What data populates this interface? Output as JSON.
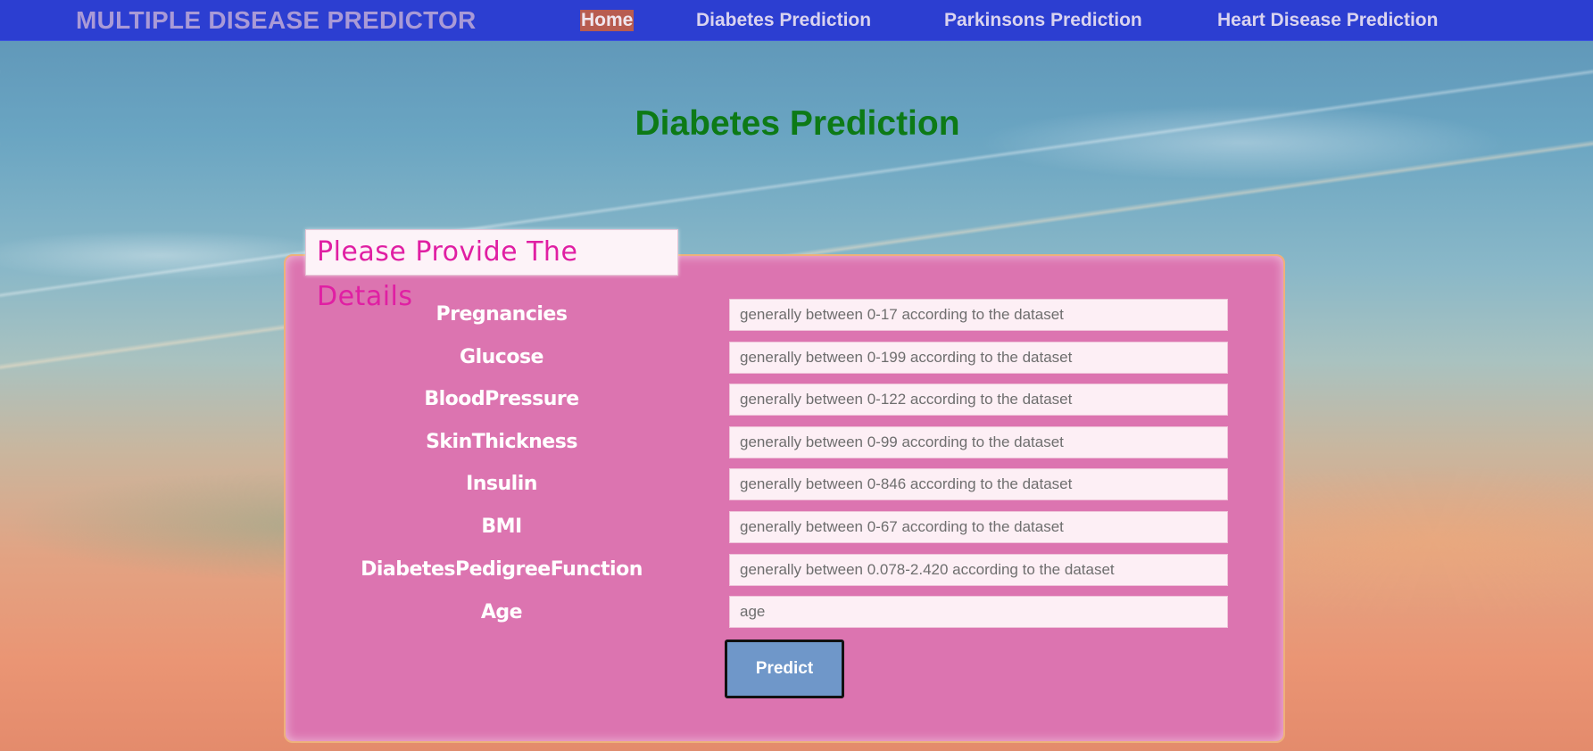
{
  "navbar": {
    "brand": "MULTIPLE DISEASE PREDICTOR",
    "items": [
      {
        "label": "Home",
        "active": true
      },
      {
        "label": "Diabetes Prediction",
        "active": false
      },
      {
        "label": "Parkinsons Prediction",
        "active": false
      },
      {
        "label": "Heart Disease Prediction",
        "active": false
      }
    ]
  },
  "page": {
    "title": "Diabetes Prediction"
  },
  "form": {
    "legend": "Please Provide The Details",
    "fields": [
      {
        "label": "Pregnancies",
        "value": "",
        "placeholder": "generally between 0-17 according to the dataset"
      },
      {
        "label": "Glucose",
        "value": "",
        "placeholder": "generally between 0-199 according to the dataset"
      },
      {
        "label": "BloodPressure",
        "value": "",
        "placeholder": "generally between 0-122 according to the dataset"
      },
      {
        "label": "SkinThickness",
        "value": "",
        "placeholder": "generally between 0-99 according to the dataset"
      },
      {
        "label": "Insulin",
        "value": "",
        "placeholder": "generally between 0-846 according to the dataset"
      },
      {
        "label": "BMI",
        "value": "",
        "placeholder": "generally between 0-67 according to the dataset"
      },
      {
        "label": "DiabetesPedigreeFunction",
        "value": "",
        "placeholder": "generally between 0.078-2.420 according to the dataset"
      },
      {
        "label": "Age",
        "value": "",
        "placeholder": "age"
      }
    ],
    "submit_label": "Predict"
  },
  "colors": {
    "navbar": "#2c3ed1",
    "brand": "#a99ad7",
    "active_nav_bg": "#b85c50",
    "title": "#0d7a16",
    "panel": "#dc74b0",
    "legend_text": "#e01fa3",
    "button": "#6f97c9"
  }
}
